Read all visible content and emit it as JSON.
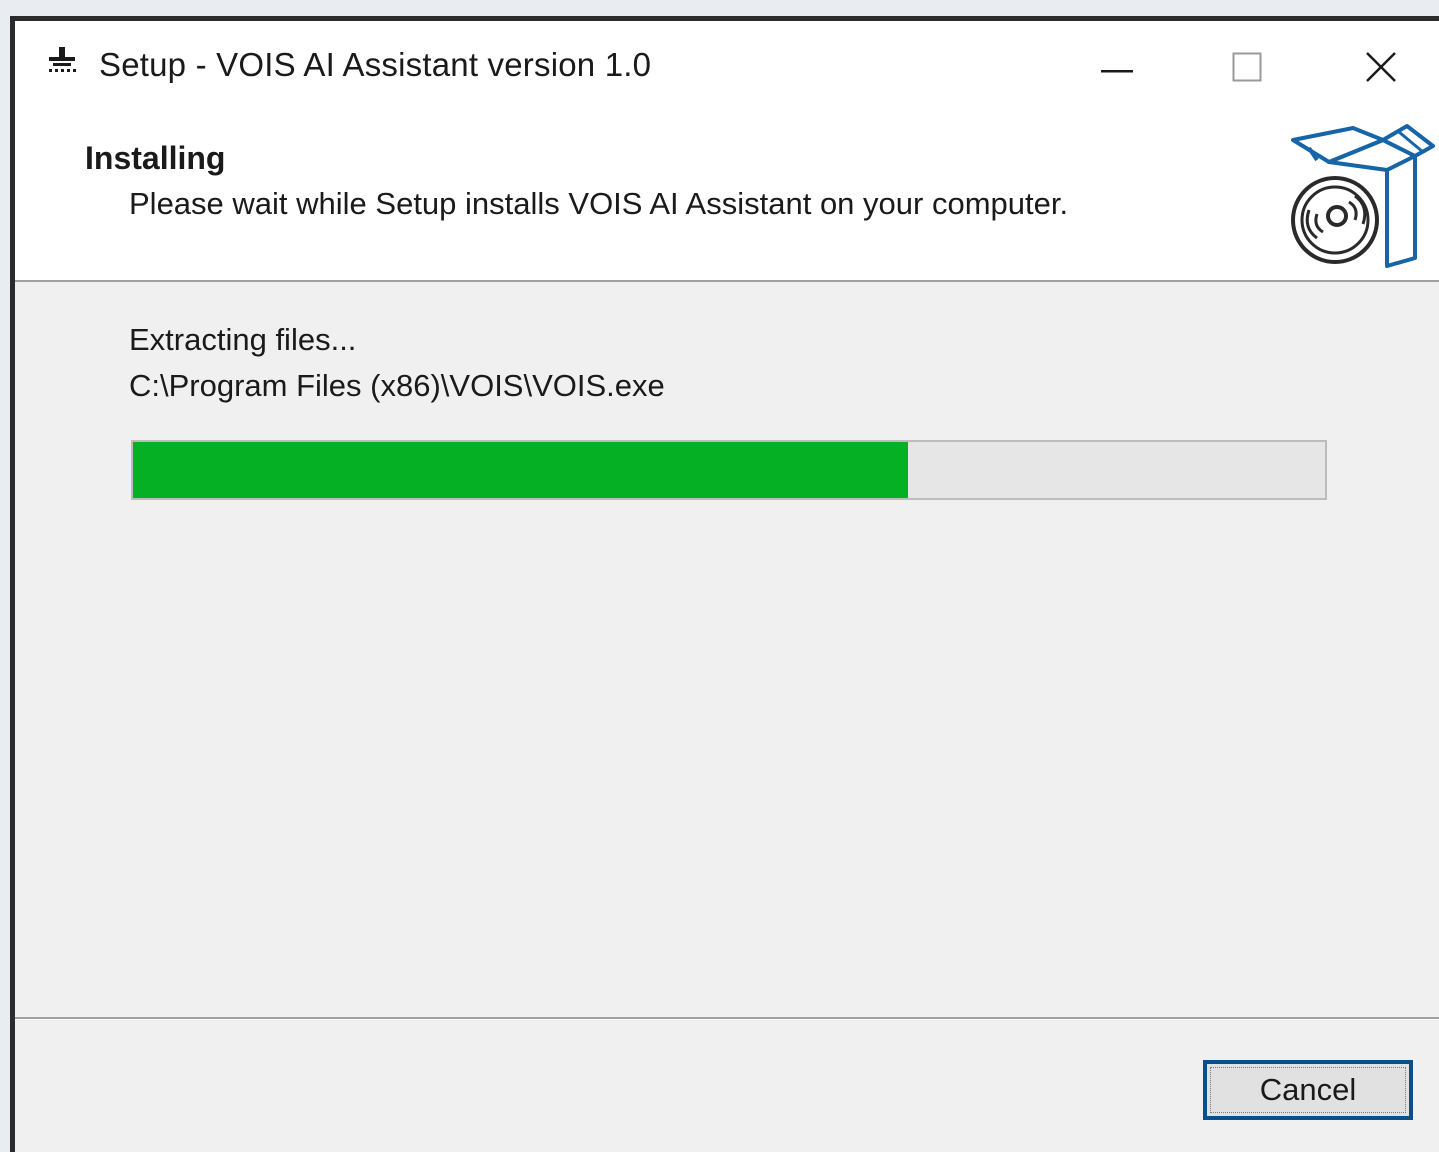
{
  "window": {
    "title": "Setup - VOIS AI Assistant version 1.0",
    "app_icon": "setup-installer-icon",
    "controls": {
      "minimize_icon": "minimize-icon",
      "maximize_icon": "maximize-icon",
      "close_icon": "close-icon"
    }
  },
  "header": {
    "title": "Installing",
    "subtitle": "Please wait while Setup installs VOIS AI Assistant on your computer.",
    "graphic_icon": "software-box-disc-icon"
  },
  "content": {
    "status": "Extracting files...",
    "current_file": "C:\\Program Files (x86)\\VOIS\\VOIS.exe",
    "progress_percent": 65
  },
  "footer": {
    "cancel_label": "Cancel"
  },
  "colors": {
    "progress_fill": "#06b025",
    "progress_track": "#e6e6e6",
    "focus_border": "#0b4f8a",
    "graphic_accent": "#1565a8"
  }
}
